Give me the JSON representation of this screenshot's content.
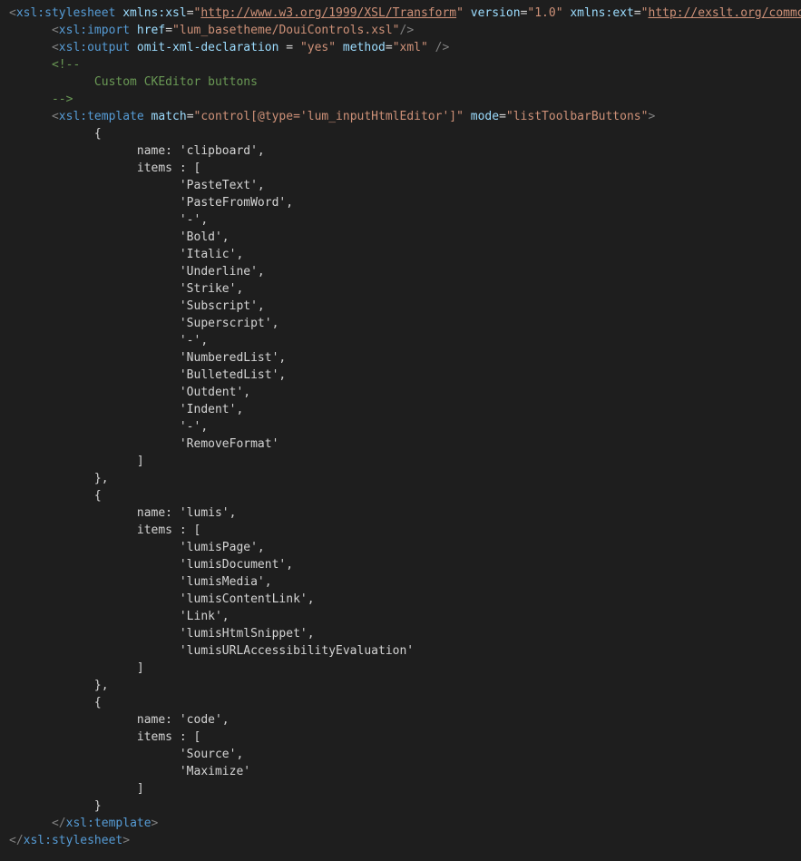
{
  "editor": {
    "colors": {
      "background": "#1e1e1e",
      "text": "#d4d4d4",
      "tag": "#569cd6",
      "attribute": "#9cdcfe",
      "string": "#ce9178",
      "comment": "#6a9955",
      "bracket": "#808080"
    },
    "lines": [
      [
        {
          "t": "<",
          "c": "bracket"
        },
        {
          "t": "xsl:stylesheet",
          "c": "tag"
        },
        {
          "t": " ",
          "c": "text"
        },
        {
          "t": "xmlns:xsl",
          "c": "attr"
        },
        {
          "t": "=",
          "c": "text"
        },
        {
          "t": "\"",
          "c": "string"
        },
        {
          "t": "http://www.w3.org/1999/XSL/Transform",
          "c": "url"
        },
        {
          "t": "\"",
          "c": "string"
        },
        {
          "t": " ",
          "c": "text"
        },
        {
          "t": "version",
          "c": "attr"
        },
        {
          "t": "=",
          "c": "text"
        },
        {
          "t": "\"1.0\"",
          "c": "string"
        },
        {
          "t": " ",
          "c": "text"
        },
        {
          "t": "xmlns:ext",
          "c": "attr"
        },
        {
          "t": "=",
          "c": "text"
        },
        {
          "t": "\"",
          "c": "string"
        },
        {
          "t": "http://exslt.org/common",
          "c": "url"
        },
        {
          "t": "\"",
          "c": "string"
        }
      ],
      [
        {
          "t": "      ",
          "c": "text"
        },
        {
          "t": "<",
          "c": "bracket"
        },
        {
          "t": "xsl:import",
          "c": "tag"
        },
        {
          "t": " ",
          "c": "text"
        },
        {
          "t": "href",
          "c": "attr"
        },
        {
          "t": "=",
          "c": "text"
        },
        {
          "t": "\"lum_basetheme/DouiControls.xsl\"",
          "c": "string"
        },
        {
          "t": "/>",
          "c": "bracket"
        }
      ],
      [
        {
          "t": "      ",
          "c": "text"
        },
        {
          "t": "<",
          "c": "bracket"
        },
        {
          "t": "xsl:output",
          "c": "tag"
        },
        {
          "t": " ",
          "c": "text"
        },
        {
          "t": "omit-xml-declaration",
          "c": "attr"
        },
        {
          "t": " = ",
          "c": "text"
        },
        {
          "t": "\"yes\"",
          "c": "string"
        },
        {
          "t": " ",
          "c": "text"
        },
        {
          "t": "method",
          "c": "attr"
        },
        {
          "t": "=",
          "c": "text"
        },
        {
          "t": "\"xml\"",
          "c": "string"
        },
        {
          "t": " ",
          "c": "text"
        },
        {
          "t": "/>",
          "c": "bracket"
        }
      ],
      [
        {
          "t": "      ",
          "c": "text"
        },
        {
          "t": "<!--",
          "c": "comment"
        }
      ],
      [
        {
          "t": "            Custom CKEditor buttons",
          "c": "comment"
        }
      ],
      [
        {
          "t": "      ",
          "c": "text"
        },
        {
          "t": "-->",
          "c": "comment"
        }
      ],
      [
        {
          "t": "      ",
          "c": "text"
        },
        {
          "t": "<",
          "c": "bracket"
        },
        {
          "t": "xsl:template",
          "c": "tag"
        },
        {
          "t": " ",
          "c": "text"
        },
        {
          "t": "match",
          "c": "attr"
        },
        {
          "t": "=",
          "c": "text"
        },
        {
          "t": "\"control[@type='lum_inputHtmlEditor']\"",
          "c": "string"
        },
        {
          "t": " ",
          "c": "text"
        },
        {
          "t": "mode",
          "c": "attr"
        },
        {
          "t": "=",
          "c": "text"
        },
        {
          "t": "\"listToolbarButtons\"",
          "c": "string"
        },
        {
          "t": ">",
          "c": "bracket"
        }
      ],
      [
        {
          "t": "            {",
          "c": "text"
        }
      ],
      [
        {
          "t": "                  name: 'clipboard',",
          "c": "text"
        }
      ],
      [
        {
          "t": "                  items : [",
          "c": "text"
        }
      ],
      [
        {
          "t": "                        'PasteText',",
          "c": "text"
        }
      ],
      [
        {
          "t": "                        'PasteFromWord',",
          "c": "text"
        }
      ],
      [
        {
          "t": "                        '-',",
          "c": "text"
        }
      ],
      [
        {
          "t": "                        'Bold',",
          "c": "text"
        }
      ],
      [
        {
          "t": "                        'Italic',",
          "c": "text"
        }
      ],
      [
        {
          "t": "                        'Underline',",
          "c": "text"
        }
      ],
      [
        {
          "t": "                        'Strike',",
          "c": "text"
        }
      ],
      [
        {
          "t": "                        'Subscript',",
          "c": "text"
        }
      ],
      [
        {
          "t": "                        'Superscript',",
          "c": "text"
        }
      ],
      [
        {
          "t": "                        '-',",
          "c": "text"
        }
      ],
      [
        {
          "t": "                        'NumberedList',",
          "c": "text"
        }
      ],
      [
        {
          "t": "                        'BulletedList',",
          "c": "text"
        }
      ],
      [
        {
          "t": "                        'Outdent',",
          "c": "text"
        }
      ],
      [
        {
          "t": "                        'Indent',",
          "c": "text"
        }
      ],
      [
        {
          "t": "                        '-',",
          "c": "text"
        }
      ],
      [
        {
          "t": "                        'RemoveFormat'",
          "c": "text"
        }
      ],
      [
        {
          "t": "                  ]",
          "c": "text"
        }
      ],
      [
        {
          "t": "            },",
          "c": "text"
        }
      ],
      [
        {
          "t": "            {",
          "c": "text"
        }
      ],
      [
        {
          "t": "                  name: 'lumis',",
          "c": "text"
        }
      ],
      [
        {
          "t": "                  items : [",
          "c": "text"
        }
      ],
      [
        {
          "t": "                        'lumisPage',",
          "c": "text"
        }
      ],
      [
        {
          "t": "                        'lumisDocument',",
          "c": "text"
        }
      ],
      [
        {
          "t": "                        'lumisMedia',",
          "c": "text"
        }
      ],
      [
        {
          "t": "                        'lumisContentLink',",
          "c": "text"
        }
      ],
      [
        {
          "t": "                        'Link',",
          "c": "text"
        }
      ],
      [
        {
          "t": "                        'lumisHtmlSnippet',",
          "c": "text"
        }
      ],
      [
        {
          "t": "                        'lumisURLAccessibilityEvaluation'",
          "c": "text"
        }
      ],
      [
        {
          "t": "                  ]",
          "c": "text"
        }
      ],
      [
        {
          "t": "            },",
          "c": "text"
        }
      ],
      [
        {
          "t": "            {",
          "c": "text"
        }
      ],
      [
        {
          "t": "                  name: 'code',",
          "c": "text"
        }
      ],
      [
        {
          "t": "                  items : [",
          "c": "text"
        }
      ],
      [
        {
          "t": "                        'Source',",
          "c": "text"
        }
      ],
      [
        {
          "t": "                        'Maximize'",
          "c": "text"
        }
      ],
      [
        {
          "t": "                  ]",
          "c": "text"
        }
      ],
      [
        {
          "t": "            }",
          "c": "text"
        }
      ],
      [
        {
          "t": "      ",
          "c": "text"
        },
        {
          "t": "</",
          "c": "bracket"
        },
        {
          "t": "xsl:template",
          "c": "tag"
        },
        {
          "t": ">",
          "c": "bracket"
        }
      ],
      [
        {
          "t": "</",
          "c": "bracket"
        },
        {
          "t": "xsl:stylesheet",
          "c": "tag"
        },
        {
          "t": ">",
          "c": "bracket"
        }
      ]
    ]
  }
}
